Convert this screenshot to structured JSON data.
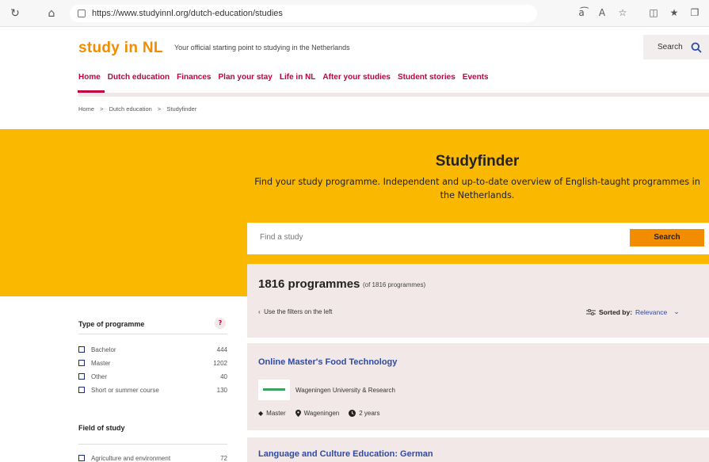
{
  "browser": {
    "url": "https://www.studyinnl.org/dutch-education/studies",
    "icons": [
      "refresh-icon",
      "home-icon",
      "lock-icon",
      "read-aloud-icon",
      "text-size-icon",
      "favorite-icon",
      "split-screen-icon",
      "favorites-icon",
      "collections-icon"
    ]
  },
  "header": {
    "logo": "study in NL",
    "tagline": "Your official starting point to studying in the Netherlands",
    "search_label": "Search"
  },
  "nav": {
    "items": [
      "Home",
      "Dutch education",
      "Finances",
      "Plan your stay",
      "Life in NL",
      "After your studies",
      "Student stories",
      "Events"
    ]
  },
  "breadcrumb": [
    "Home",
    ">",
    "Dutch education",
    ">",
    "Studyfinder"
  ],
  "hero": {
    "title": "Studyfinder",
    "subtitle": "Find your study programme. Independent and up-to-date overview of English-taught programmes in the Netherlands."
  },
  "search": {
    "placeholder": "Find a study",
    "button": "Search"
  },
  "results": {
    "count": "1816 programmes",
    "count_sub": "(of 1816 programmes)",
    "filters_hint": "Use the filters on the left",
    "sorted_label": "Sorted by:",
    "sorted_value": "Relevance"
  },
  "sidebar": {
    "type_title": "Type of programme",
    "help": "?",
    "types": [
      {
        "label": "Bachelor",
        "count": "444"
      },
      {
        "label": "Master",
        "count": "1202"
      },
      {
        "label": "Other",
        "count": "40"
      },
      {
        "label": "Short or summer course",
        "count": "130"
      }
    ],
    "field_title": "Field of study",
    "fields": [
      {
        "label": "Agriculture and environment",
        "count": "72"
      }
    ]
  },
  "cards": [
    {
      "title": "Online Master's Food Technology",
      "institution": "Wageningen University & Research",
      "level": "Master",
      "city": "Wageningen",
      "duration": "2 years"
    },
    {
      "title": "Language and Culture Education: German"
    }
  ],
  "colors": {
    "brand_orange": "#f28c00",
    "nav_red": "#c3003f",
    "hero_yellow": "#fbb800",
    "link_blue": "#2e4aa0",
    "panel_pink": "#f2e8e8"
  }
}
